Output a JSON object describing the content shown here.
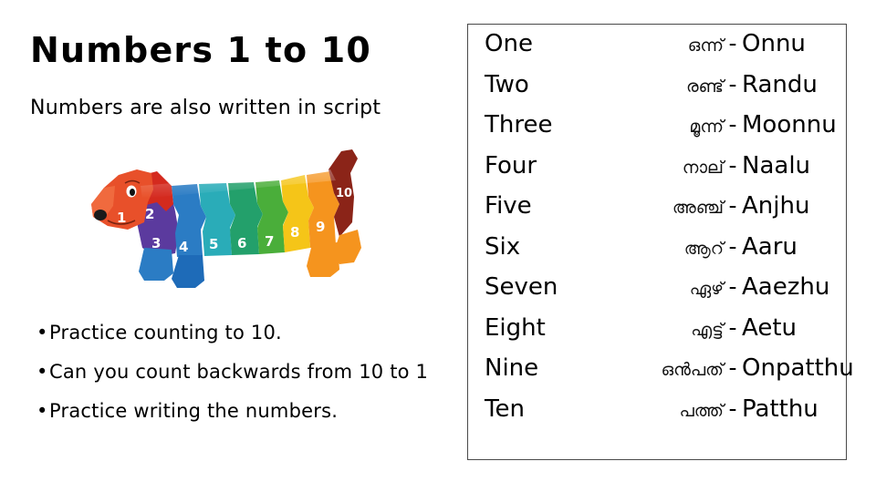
{
  "slide": {
    "title": "Numbers 1 to 10",
    "subtitle": "Numbers are also written in script",
    "background_color": "#ffffff",
    "panel_border_color": "#4a4a4a"
  },
  "bullets": [
    {
      "marker": "•",
      "text": "Practice counting to 10."
    },
    {
      "marker": "•",
      "text": "Can you count backwards from 10 to 1"
    },
    {
      "marker": "•",
      "text": "Practice writing the numbers."
    }
  ],
  "puzzle": {
    "alt": "wooden dachshund dog jigsaw puzzle with ten numbered rainbow pieces",
    "pieces": [
      {
        "number": "1",
        "color": "#E8502A"
      },
      {
        "number": "2",
        "color": "#D42A1E"
      },
      {
        "number": "3",
        "color": "#5B3A9E"
      },
      {
        "number": "4",
        "color": "#2B7CC4"
      },
      {
        "number": "5",
        "color": "#2AACB8"
      },
      {
        "number": "6",
        "color": "#23A06B"
      },
      {
        "number": "7",
        "color": "#4AAE3A"
      },
      {
        "number": "8",
        "color": "#F5C518"
      },
      {
        "number": "9",
        "color": "#F5941E"
      },
      {
        "number": "10",
        "color": "#8B2418"
      }
    ]
  },
  "script_table": {
    "rows": [
      {
        "english": "One",
        "script": "ഒന്ന്",
        "dash": "-",
        "transliteration": "Onnu"
      },
      {
        "english": "Two",
        "script": "രണ്ട്",
        "dash": "-",
        "transliteration": "Randu"
      },
      {
        "english": "Three",
        "script": "മൂന്ന്",
        "dash": "-",
        "transliteration": "Moonnu"
      },
      {
        "english": "Four",
        "script": "നാല്",
        "dash": "-",
        "transliteration": "Naalu"
      },
      {
        "english": "Five",
        "script": "അഞ്ച്",
        "dash": "-",
        "transliteration": "Anjhu"
      },
      {
        "english": "Six",
        "script": "ആറ്",
        "dash": "-",
        "transliteration": "Aaru"
      },
      {
        "english": "Seven",
        "script": "ഏഴ്",
        "dash": "-",
        "transliteration": "Aaezhu"
      },
      {
        "english": "Eight",
        "script": "എട്ട്",
        "dash": "-",
        "transliteration": "Aetu"
      },
      {
        "english": "Nine",
        "script": "ഒൻപത്",
        "dash": "-",
        "transliteration": "Onpatthu"
      },
      {
        "english": "Ten",
        "script": "പത്ത്",
        "dash": "-",
        "transliteration": "Patthu"
      }
    ]
  }
}
